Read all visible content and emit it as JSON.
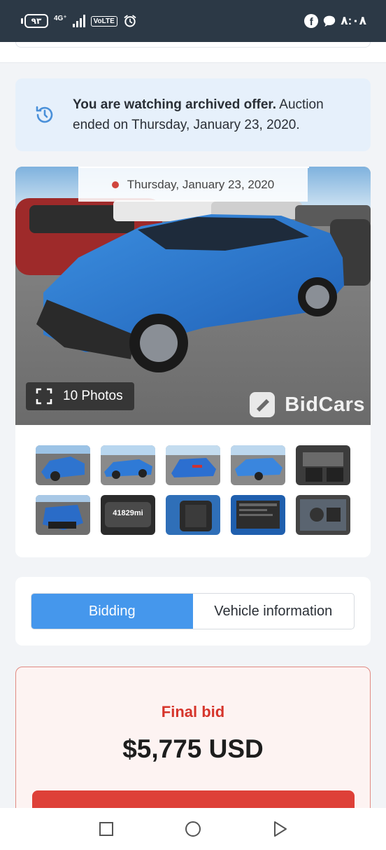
{
  "status_bar": {
    "battery": "٩٣",
    "network": "4G⁺",
    "volte": "VoLTE",
    "time": "٨:٠٨",
    "icons": [
      "signal-icon",
      "alarm-icon",
      "facebook-icon",
      "chat-bubble-icon"
    ]
  },
  "notice": {
    "bold": "You are watching archived offer.",
    "text": " Auction ended on Thursday, January 23, 2020.",
    "icon": "history-icon"
  },
  "gallery": {
    "date": "Thursday, January 23, 2020",
    "photos_label": "10 Photos",
    "watermark": "BidCars",
    "thumbnails": [
      {
        "name": "thumb-front-left-damage"
      },
      {
        "name": "thumb-side-left"
      },
      {
        "name": "thumb-rear-left"
      },
      {
        "name": "thumb-rear-right"
      },
      {
        "name": "thumb-interior-front"
      },
      {
        "name": "thumb-front-damage"
      },
      {
        "name": "thumb-odometer",
        "text": "41829mi"
      },
      {
        "name": "thumb-interior-rear"
      },
      {
        "name": "thumb-vin-label"
      },
      {
        "name": "thumb-engine"
      }
    ]
  },
  "tabs": [
    {
      "label": "Bidding",
      "active": true
    },
    {
      "label": "Vehicle information",
      "active": false
    }
  ],
  "final_bid": {
    "label": "Final bid",
    "value": "$5,775 USD"
  },
  "colors": {
    "accent": "#4597ec",
    "danger": "#de4038",
    "status_bar": "#2c3946",
    "notice_bg": "#e6f0fb"
  },
  "nav": [
    "recents-square-icon",
    "home-circle-icon",
    "back-triangle-icon"
  ]
}
